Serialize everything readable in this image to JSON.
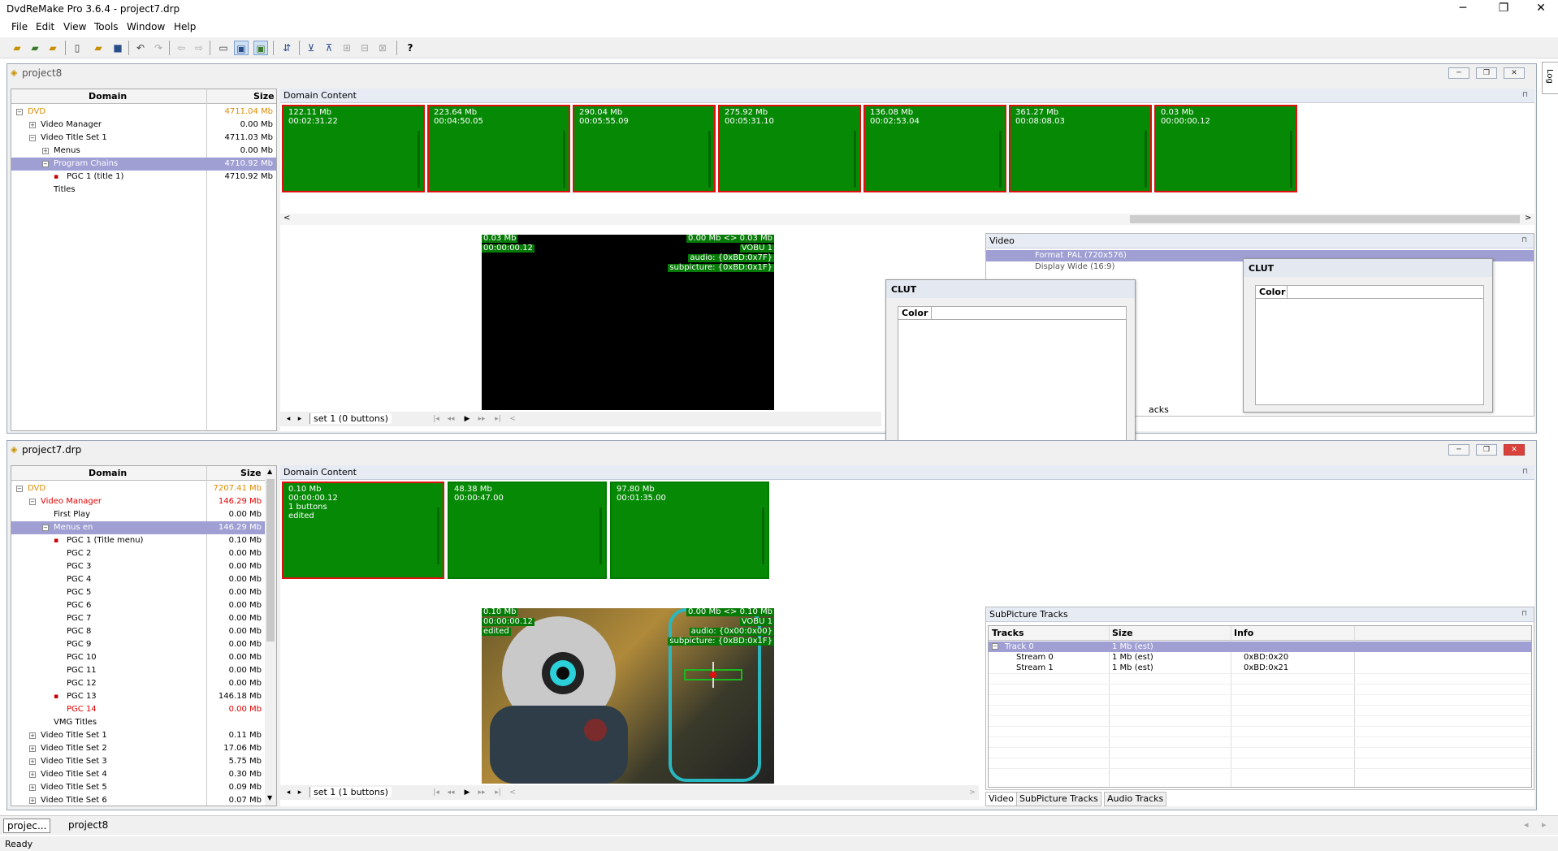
{
  "app": {
    "title": "DvdReMake Pro 3.6.4 - project7.drp",
    "status": "Ready",
    "right_tab": "Log"
  },
  "window_controls": {
    "minimize": "─",
    "restore": "❐",
    "close": "✕"
  },
  "menu": [
    "File",
    "Edit",
    "View",
    "Tools",
    "Window",
    "Help"
  ],
  "toolbar": [
    "open-folder-icon",
    "open-project-icon",
    "open-recent-icon",
    "new-icon",
    "open-icon",
    "save-icon",
    "undo-icon",
    "redo-icon",
    "nav-back-icon",
    "nav-forward-icon",
    "view-1-icon",
    "view-2-icon",
    "view-3-icon",
    "export-icon",
    "import-icon",
    "tool-a-icon",
    "tool-b-icon",
    "tool-c-icon",
    "tool-d-icon",
    "help-icon"
  ],
  "project8": {
    "title": "project8",
    "tree_headers": {
      "domain": "Domain",
      "size": "Size"
    },
    "tree": [
      {
        "label": "DVD",
        "size": "4711.04 Mb",
        "level": 0,
        "tog": "−",
        "style": "orange"
      },
      {
        "label": "Video Manager",
        "size": "0.00 Mb",
        "level": 1,
        "tog": "+"
      },
      {
        "label": "Video Title Set 1",
        "size": "4711.03 Mb",
        "level": 1,
        "tog": "−"
      },
      {
        "label": "Menus",
        "size": "0.00 Mb",
        "level": 2,
        "tog": "+"
      },
      {
        "label": "Program Chains",
        "size": "4710.92 Mb",
        "level": 2,
        "tog": "−",
        "sel": true
      },
      {
        "label": "PGC 1  (title 1)",
        "size": "4710.92 Mb",
        "level": 3,
        "icon": true
      },
      {
        "label": "Titles",
        "size": "",
        "level": 2
      }
    ],
    "domain_content": "Domain Content",
    "thumbs": [
      {
        "size": "122.11 Mb",
        "time": "00:02:31.22"
      },
      {
        "size": "223.64 Mb",
        "time": "00:04:50.05"
      },
      {
        "size": "290.04 Mb",
        "time": "00:05:55.09"
      },
      {
        "size": "275.92 Mb",
        "time": "00:05:31.10"
      },
      {
        "size": "136.08 Mb",
        "time": "00:02:53.04"
      },
      {
        "size": "361.27 Mb",
        "time": "00:08:08.03"
      },
      {
        "size": "0.03 Mb",
        "time": "00:00:00.12"
      }
    ],
    "scroll_left": "<",
    "scroll_right": ">",
    "preview": {
      "size": "0.03 Mb",
      "time": "00:00:00.12",
      "info1": "0.00 Mb <> 0.03 Mb",
      "info2": "VOBU 1",
      "info3": "audio: {0xBD:0x7F}",
      "info4": "subpicture: {0xBD:0x1F}"
    },
    "set_label": "set 1 (0 buttons)",
    "video_panel": {
      "title": "Video",
      "rows": [
        [
          "Format",
          "PAL (720x576)"
        ],
        [
          "Display",
          "Wide (16:9)"
        ]
      ]
    },
    "tabs_partial": "acks"
  },
  "clut_windows": [
    {
      "title": "CLUT",
      "column": "Color"
    },
    {
      "title": "CLUT",
      "column": "Color"
    }
  ],
  "project7": {
    "title": "project7.drp",
    "tree_headers": {
      "domain": "Domain",
      "size": "Size"
    },
    "tree": [
      {
        "label": "DVD",
        "size": "7207.41 Mb",
        "level": 0,
        "tog": "−",
        "style": "orange"
      },
      {
        "label": "Video Manager",
        "size": "146.29 Mb",
        "level": 1,
        "tog": "−",
        "style": "red"
      },
      {
        "label": "First Play",
        "size": "0.00 Mb",
        "level": 2
      },
      {
        "label": "Menus en",
        "size": "146.29 Mb",
        "level": 2,
        "tog": "−",
        "sel": true
      },
      {
        "label": "PGC 1 (Title menu)",
        "size": "0.10 Mb",
        "level": 3,
        "icon": true
      },
      {
        "label": "PGC 2",
        "size": "0.00 Mb",
        "level": 3
      },
      {
        "label": "PGC 3",
        "size": "0.00 Mb",
        "level": 3
      },
      {
        "label": "PGC 4",
        "size": "0.00 Mb",
        "level": 3
      },
      {
        "label": "PGC 5",
        "size": "0.00 Mb",
        "level": 3
      },
      {
        "label": "PGC 6",
        "size": "0.00 Mb",
        "level": 3
      },
      {
        "label": "PGC 7",
        "size": "0.00 Mb",
        "level": 3
      },
      {
        "label": "PGC 8",
        "size": "0.00 Mb",
        "level": 3
      },
      {
        "label": "PGC 9",
        "size": "0.00 Mb",
        "level": 3
      },
      {
        "label": "PGC 10",
        "size": "0.00 Mb",
        "level": 3
      },
      {
        "label": "PGC 11",
        "size": "0.00 Mb",
        "level": 3
      },
      {
        "label": "PGC 12",
        "size": "0.00 Mb",
        "level": 3
      },
      {
        "label": "PGC 13",
        "size": "146.18 Mb",
        "level": 3,
        "icon": true
      },
      {
        "label": "PGC 14",
        "size": "0.00 Mb",
        "level": 3,
        "style": "red"
      },
      {
        "label": "VMG Titles",
        "size": "",
        "level": 2
      },
      {
        "label": "Video Title Set 1",
        "size": "0.11 Mb",
        "level": 1,
        "tog": "+"
      },
      {
        "label": "Video Title Set 2",
        "size": "17.06 Mb",
        "level": 1,
        "tog": "+"
      },
      {
        "label": "Video Title Set 3",
        "size": "5.75 Mb",
        "level": 1,
        "tog": "+"
      },
      {
        "label": "Video Title Set 4",
        "size": "0.30 Mb",
        "level": 1,
        "tog": "+"
      },
      {
        "label": "Video Title Set 5",
        "size": "0.09 Mb",
        "level": 1,
        "tog": "+"
      },
      {
        "label": "Video Title Set 6",
        "size": "0.07 Mb",
        "level": 1,
        "tog": "+"
      }
    ],
    "domain_content": "Domain Content",
    "thumbs": [
      {
        "size": "0.10 Mb",
        "time": "00:00:00.12",
        "extra1": "1 buttons",
        "extra2": "edited"
      },
      {
        "size": "48.38 Mb",
        "time": "00:00:47.00"
      },
      {
        "size": "97.80 Mb",
        "time": "00:01:35.00"
      }
    ],
    "preview": {
      "size": "0.10 Mb",
      "time": "00:00:00.12",
      "edited": "edited",
      "info1": "0.00 Mb <> 0.10 Mb",
      "info2": "VOBU 1",
      "info3": "audio: {0x00:0x00}",
      "info4": "subpicture: {0xBD:0x1F}"
    },
    "set_label": "set 1 (1 buttons)",
    "subpic": {
      "title": "SubPicture Tracks",
      "headers": [
        "Tracks",
        "Size",
        "Info"
      ],
      "rows": [
        {
          "track": "Track 0",
          "size": "1 Mb (est)",
          "info": "",
          "sel": true
        },
        {
          "track": "Stream 0",
          "size": "1 Mb (est)",
          "info": "0xBD:0x20"
        },
        {
          "track": "Stream 1",
          "size": "1 Mb (est)",
          "info": "0xBD:0x21"
        }
      ]
    },
    "tabs": [
      "Video",
      "SubPicture Tracks",
      "Audio Tracks"
    ]
  },
  "taskbar": [
    "projec...",
    "project8"
  ]
}
